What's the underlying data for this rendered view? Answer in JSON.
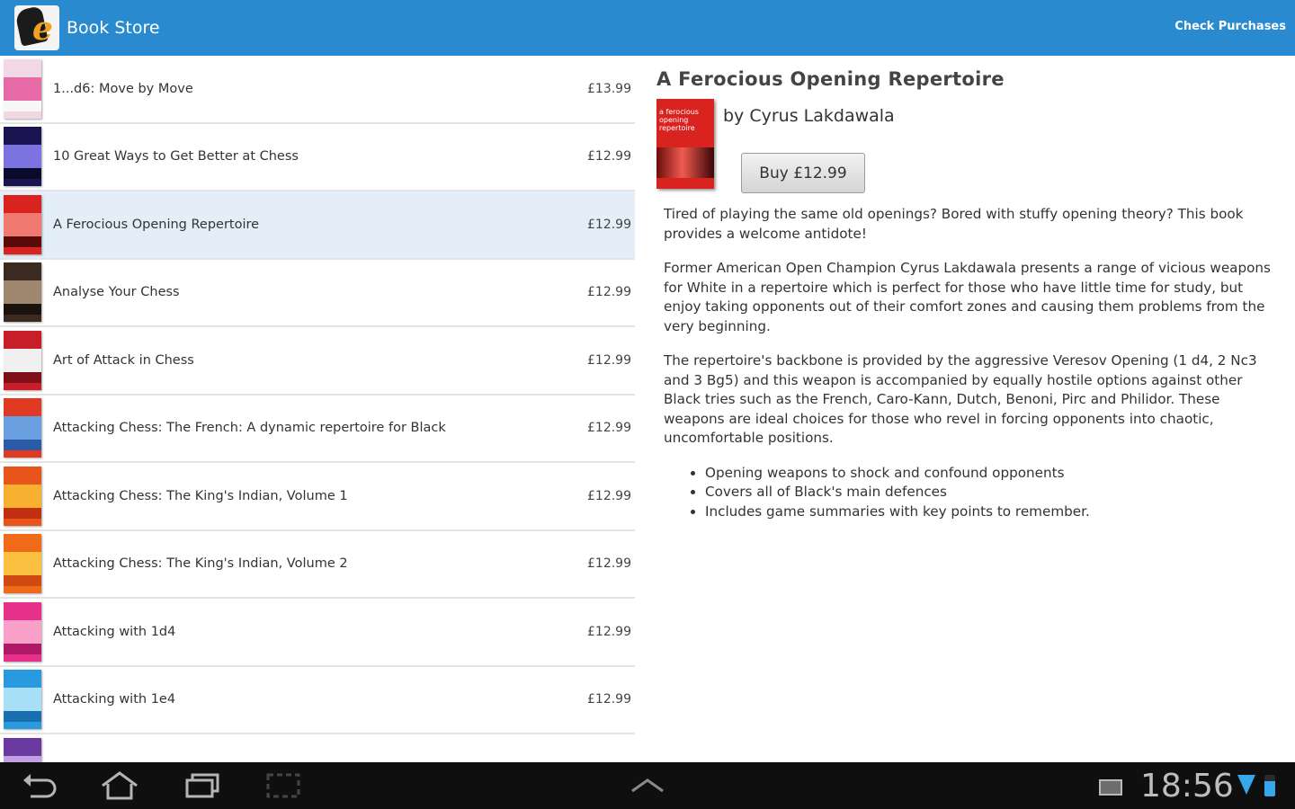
{
  "actionbar": {
    "title": "Book Store",
    "check_purchases": "Check Purchases"
  },
  "books": [
    {
      "title": "1...d6: Move by Move",
      "price": "£13.99",
      "colors": [
        "#f2d8e4",
        "#e66aa6",
        "#f7f7f7"
      ]
    },
    {
      "title": "10 Great Ways to Get Better at Chess",
      "price": "£12.99",
      "colors": [
        "#1a1450",
        "#7a73e0",
        "#0a0a2a"
      ]
    },
    {
      "title": "A Ferocious Opening Repertoire",
      "price": "£12.99",
      "colors": [
        "#d8231f",
        "#f07a70",
        "#5a0a08"
      ],
      "selected": true
    },
    {
      "title": "Analyse Your Chess",
      "price": "£12.99",
      "colors": [
        "#3a2a20",
        "#a08870",
        "#1a120c"
      ]
    },
    {
      "title": "Art of Attack in Chess",
      "price": "£12.99",
      "colors": [
        "#c81e2a",
        "#f0f0f0",
        "#801018"
      ]
    },
    {
      "title": "Attacking Chess: The French: A dynamic repertoire for Black",
      "price": "£12.99",
      "colors": [
        "#e03a22",
        "#6aa0e0",
        "#2a5aa8"
      ]
    },
    {
      "title": "Attacking Chess: The King's Indian, Volume 1",
      "price": "£12.99",
      "colors": [
        "#e8541a",
        "#f7b030",
        "#c03010"
      ]
    },
    {
      "title": "Attacking Chess: The King's Indian, Volume 2",
      "price": "£12.99",
      "colors": [
        "#f06a1a",
        "#fbc040",
        "#d04a10"
      ]
    },
    {
      "title": "Attacking with 1d4",
      "price": "£12.99",
      "colors": [
        "#e6308a",
        "#f8a0c8",
        "#b01868"
      ]
    },
    {
      "title": "Attacking with 1e4",
      "price": "£12.99",
      "colors": [
        "#2a9ae0",
        "#a8e0f8",
        "#1870b0"
      ]
    },
    {
      "title": "",
      "price": "",
      "colors": [
        "#6a3aa0",
        "#c0a0e0",
        "#4a2080"
      ]
    }
  ],
  "detail": {
    "title": "A Ferocious Opening Repertoire",
    "author": "by Cyrus Lakdawala",
    "cover_text": "a ferocious opening repertoire",
    "buy_label": "Buy £12.99",
    "paragraphs": [
      "Tired of playing the same old openings? Bored with stuffy opening theory? This book provides a welcome antidote!",
      "Former American Open Champion Cyrus Lakdawala presents a range of vicious weapons for White in a repertoire which is perfect for those who have little time for study, but enjoy taking opponents out of their comfort zones and causing them problems from the very beginning.",
      "The repertoire's backbone is provided by the aggressive Veresov Opening (1 d4, 2 Nc3 and 3 Bg5) and this weapon is accompanied by equally hostile options against other Black tries such as the French, Caro-Kann, Dutch, Benoni, Pirc and Philidor. These weapons are ideal choices for those who revel in forcing opponents into chaotic, uncomfortable positions."
    ],
    "bullets": [
      "Opening weapons to shock and confound opponents",
      "Covers all of Black's main defences",
      "Includes game summaries with key points to remember."
    ]
  },
  "status": {
    "time": "18:56"
  },
  "icons": {
    "back": "back-icon",
    "home": "home-icon",
    "recent": "recent-apps-icon",
    "screenshot": "screenshot-icon",
    "up": "chevron-up-icon",
    "mail": "mail-icon",
    "wifi": "wifi-icon",
    "battery": "battery-icon"
  }
}
